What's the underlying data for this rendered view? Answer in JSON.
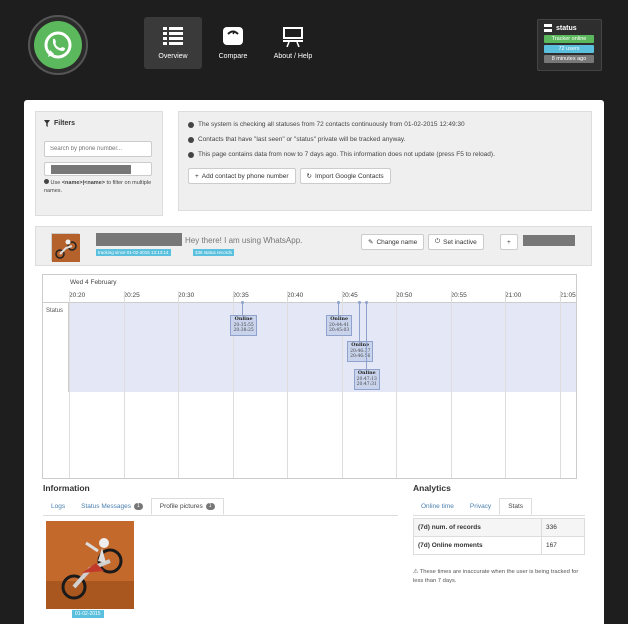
{
  "header": {
    "nav": [
      {
        "label": "Overview",
        "icon": "list-icon"
      },
      {
        "label": "Compare",
        "icon": "scale-icon"
      },
      {
        "label": "About / Help",
        "icon": "presentation-icon"
      }
    ],
    "status": {
      "title": "status",
      "items": [
        {
          "text": "Tracker online",
          "color": "#5cb85c"
        },
        {
          "text": "72 users",
          "color": "#5bc0de"
        },
        {
          "text": "8 minutes ago",
          "color": "#777777"
        }
      ]
    }
  },
  "filters": {
    "title": "Filters",
    "search_placeholder": "Search by phone number...",
    "hint_prefix": "Use ",
    "hint_code": "<name>|<name>",
    "hint_suffix": " to filter on multiple names."
  },
  "info": {
    "lines": [
      "The system is checking all statuses from 72 contacts continuously from 01-02-2015 12:49:30",
      "Contacts that have \"last seen\" or \"status\" private will be tracked anyway.",
      "This page contains data from now to 7 days ago. This information does not update (press F5 to reload)."
    ],
    "add_contact": "Add contact by phone number",
    "import_contacts": "Import Google Contacts"
  },
  "contact": {
    "status_text": "Hey there! I am using WhatsApp.",
    "tracking_badge": "tracking since 01-02-2015 13:13:14",
    "records_badge": "336 status records",
    "change_name": "Change name",
    "set_inactive": "Set inactive",
    "plus": "+"
  },
  "timeline": {
    "date": "Wed 4 February",
    "row_label": "Status",
    "ticks": [
      "20:20",
      "20:25",
      "20:30",
      "20:35",
      "20:40",
      "20:45",
      "20:50",
      "20:55",
      "21:00",
      "21:05"
    ],
    "events": [
      {
        "label": "Online",
        "start": "20:35:55",
        "end": "20:38:25"
      },
      {
        "label": "Online",
        "start": "20:44:41",
        "end": "20:45:03"
      },
      {
        "label": "Online",
        "start": "20:46:37",
        "end": "20:46:56"
      },
      {
        "label": "Online",
        "start": "20:47:13",
        "end": "20:47:31"
      }
    ]
  },
  "information": {
    "title": "Information",
    "tabs": [
      {
        "label": "Logs"
      },
      {
        "label": "Status Messages",
        "badge": "1"
      },
      {
        "label": "Profile pictures",
        "badge": "1",
        "active": true
      }
    ],
    "picture_date": "01-02-2015"
  },
  "analytics": {
    "title": "Analytics",
    "tabs": [
      "Online time",
      "Privacy",
      "Stats"
    ],
    "rows": [
      {
        "key": "(7d) num. of records",
        "value": "336"
      },
      {
        "key": "(7d) Online moments",
        "value": "167"
      }
    ],
    "note": "These times are inaccurate when the user is being tracked for less than 7 days."
  }
}
